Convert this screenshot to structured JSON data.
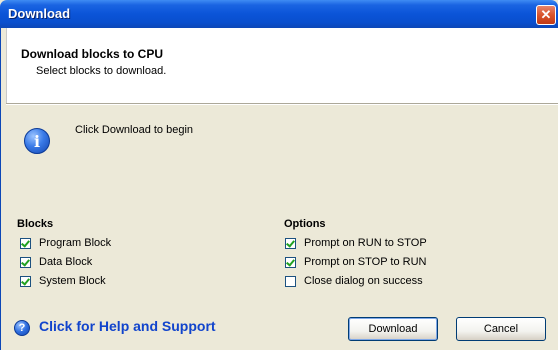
{
  "window": {
    "title": "Download",
    "close_glyph": "✕"
  },
  "header": {
    "title": "Download blocks to CPU",
    "subtitle": "Select blocks to download."
  },
  "info": {
    "icon": "info-icon",
    "glyph": "i",
    "message": "Click Download to begin"
  },
  "blocks": {
    "title": "Blocks",
    "items": [
      {
        "label": "Program Block",
        "checked": true
      },
      {
        "label": "Data Block",
        "checked": true
      },
      {
        "label": "System Block",
        "checked": true
      }
    ]
  },
  "options": {
    "title": "Options",
    "items": [
      {
        "label": "Prompt on RUN to STOP",
        "checked": true
      },
      {
        "label": "Prompt on STOP to RUN",
        "checked": true
      },
      {
        "label": "Close dialog on success",
        "checked": false
      }
    ]
  },
  "footer": {
    "help_glyph": "?",
    "help_label": "Click for Help and Support",
    "download_label": "Download",
    "cancel_label": "Cancel"
  },
  "colors": {
    "titlebar": "#0b54d8",
    "dialog_bg": "#ece9d8",
    "link": "#1144cc",
    "check": "#21a121"
  }
}
